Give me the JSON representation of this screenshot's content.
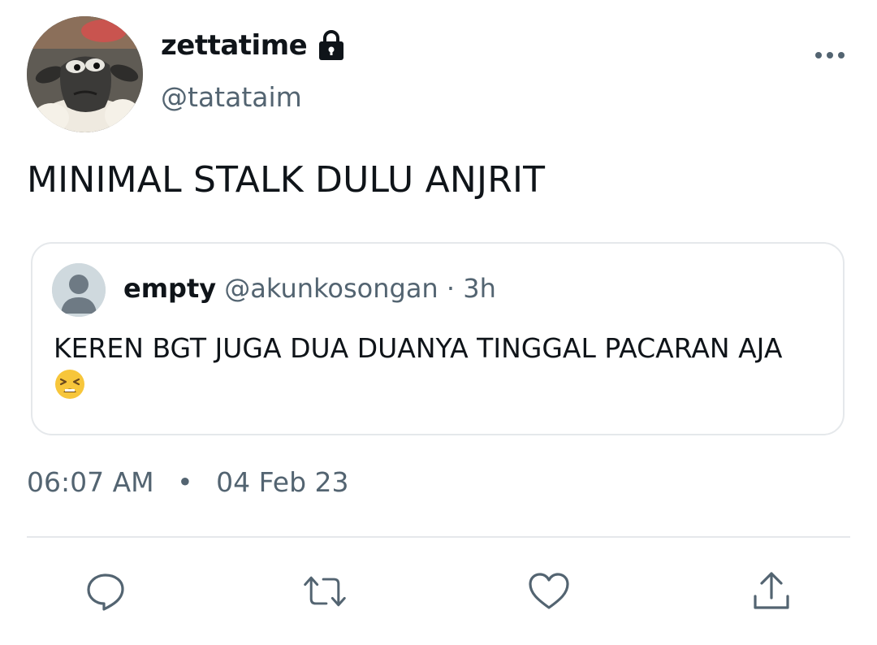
{
  "author": {
    "display_name": "zettatime",
    "handle": "@tatataim",
    "avatar_icon": "sheep-avatar",
    "protected_icon": "lock-icon"
  },
  "tweet": {
    "text": "MINIMAL STALK DULU ANJRIT",
    "time": "06:07 AM",
    "separator": "•",
    "date": "04 Feb 23"
  },
  "quoted": {
    "display_name": "empty",
    "handle": "@akunkosongan",
    "separator": "·",
    "age": "3h",
    "text": "KEREN BGT JUGA DUA DUANYA TINGGAL PACARAN AJA",
    "emoji_icon": "tired-face-emoji"
  },
  "actions": [
    {
      "icon": "reply-icon"
    },
    {
      "icon": "retweet-icon"
    },
    {
      "icon": "like-icon"
    },
    {
      "icon": "share-icon"
    }
  ],
  "colors": {
    "text": "#0f1419",
    "secondary": "#536471",
    "border": "#e5e8eb",
    "icon": "#536471"
  }
}
